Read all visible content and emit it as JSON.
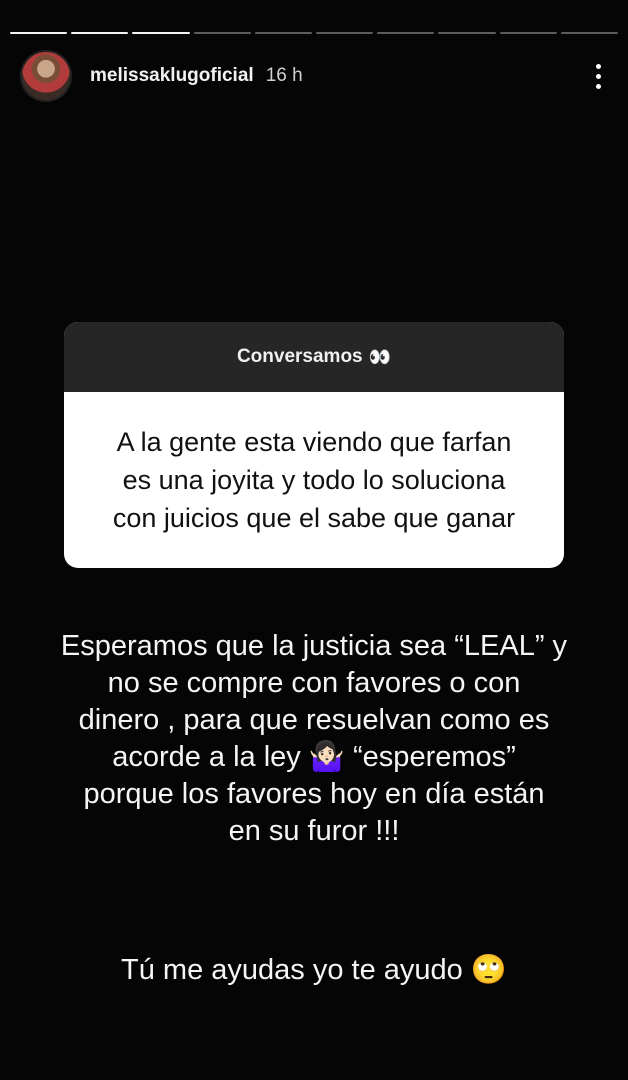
{
  "progress": {
    "segments_total": 10,
    "segments_done": 3
  },
  "header": {
    "username": "melissaklugoficial",
    "time": "16 h"
  },
  "question": {
    "title": "Conversamos",
    "title_emoji": "👀",
    "answer": "A la gente esta viendo que farfan\nes una joyita y todo lo soluciona\ncon juicios que el sabe que ganar"
  },
  "caption": {
    "text": "Esperamos que la justicia sea “LEAL” y\nno se compre con favores o con\ndinero , para que resuelvan como es\nacorde a la ley 🤷🏻‍♀️ “esperemos”\nporque los favores hoy en día están\nen su furor !!!"
  },
  "caption2": {
    "text": "Tú me ayudas yo te ayudo 🙄"
  },
  "icons": {
    "menu": "more-vertical-icon",
    "avatar": "profile-avatar"
  }
}
